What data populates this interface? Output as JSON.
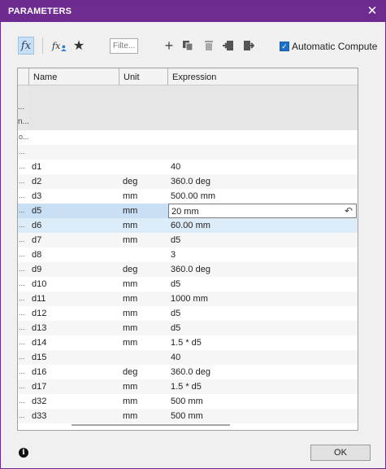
{
  "window": {
    "title": "PARAMETERS",
    "close_symbol": "✕"
  },
  "toolbar": {
    "fx_label": "fx",
    "fx_user_label": "fx",
    "filter_placeholder": "Filte...",
    "auto_compute_label": "Automatic Compute",
    "auto_compute_checked": true
  },
  "columns": {
    "name": "Name",
    "unit": "Unit",
    "expression": "Expression"
  },
  "group_rows": [
    "...",
    "n...",
    "o...",
    "..."
  ],
  "rows": [
    {
      "name": "d1",
      "unit": "",
      "expression": "40"
    },
    {
      "name": "d2",
      "unit": "deg",
      "expression": "360.0 deg"
    },
    {
      "name": "d3",
      "unit": "mm",
      "expression": "500.00 mm"
    },
    {
      "name": "d5",
      "unit": "mm",
      "expression": "20 mm"
    },
    {
      "name": "d6",
      "unit": "mm",
      "expression": "60.00 mm"
    },
    {
      "name": "d7",
      "unit": "mm",
      "expression": "d5"
    },
    {
      "name": "d8",
      "unit": "",
      "expression": "3"
    },
    {
      "name": "d9",
      "unit": "deg",
      "expression": "360.0 deg"
    },
    {
      "name": "d10",
      "unit": "mm",
      "expression": "d5"
    },
    {
      "name": "d11",
      "unit": "mm",
      "expression": "1000 mm"
    },
    {
      "name": "d12",
      "unit": "mm",
      "expression": "d5"
    },
    {
      "name": "d13",
      "unit": "mm",
      "expression": "d5"
    },
    {
      "name": "d14",
      "unit": "mm",
      "expression": "1.5 * d5"
    },
    {
      "name": "d15",
      "unit": "",
      "expression": "40"
    },
    {
      "name": "d16",
      "unit": "deg",
      "expression": "360.0 deg"
    },
    {
      "name": "d17",
      "unit": "mm",
      "expression": "1.5 * d5"
    },
    {
      "name": "d32",
      "unit": "mm",
      "expression": "500 mm"
    },
    {
      "name": "d33",
      "unit": "mm",
      "expression": "500 mm"
    }
  ],
  "row_marker": "...",
  "footer": {
    "info_symbol": "i",
    "ok_label": "OK"
  },
  "colors": {
    "titlebar": "#6e2c91",
    "selection": "#dcecf9",
    "accent": "#1f6fc5"
  }
}
